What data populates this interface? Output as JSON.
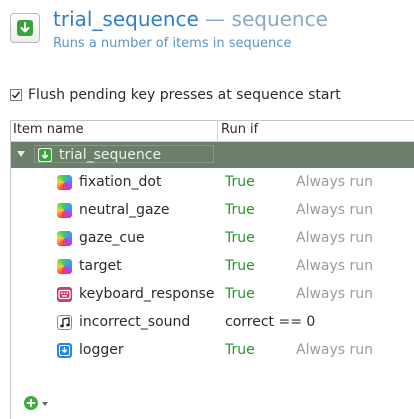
{
  "header": {
    "item_name": "trial_sequence",
    "separator": "—",
    "item_type": "sequence",
    "description": "Runs a number of items in sequence",
    "icon": "sequence-down-arrow-icon"
  },
  "options": {
    "flush_label": "Flush pending key presses at sequence start",
    "flush_checked": true
  },
  "table": {
    "columns": {
      "name": "Item name",
      "runif": "Run if"
    },
    "parent": {
      "label": "trial_sequence",
      "icon": "sequence-icon"
    },
    "rows": [
      {
        "name": "fixation_dot",
        "run_if": "True",
        "run_mode": "Always run",
        "icon": "sketchpad-icon"
      },
      {
        "name": "neutral_gaze",
        "run_if": "True",
        "run_mode": "Always run",
        "icon": "sketchpad-icon"
      },
      {
        "name": "gaze_cue",
        "run_if": "True",
        "run_mode": "Always run",
        "icon": "sketchpad-icon"
      },
      {
        "name": "target",
        "run_if": "True",
        "run_mode": "Always run",
        "icon": "sketchpad-icon"
      },
      {
        "name": "keyboard_response",
        "run_if": "True",
        "run_mode": "Always run",
        "icon": "keyboard-icon"
      },
      {
        "name": "incorrect_sound",
        "run_if": "correct == 0",
        "run_mode": "",
        "icon": "sound-icon"
      },
      {
        "name": "logger",
        "run_if": "True",
        "run_mode": "Always run",
        "icon": "logger-icon"
      }
    ]
  },
  "colors": {
    "title": "#2f7ec9",
    "selected_row": "#6b7f6b",
    "true_value": "#1e9a1e",
    "muted": "#9a9a9a"
  }
}
